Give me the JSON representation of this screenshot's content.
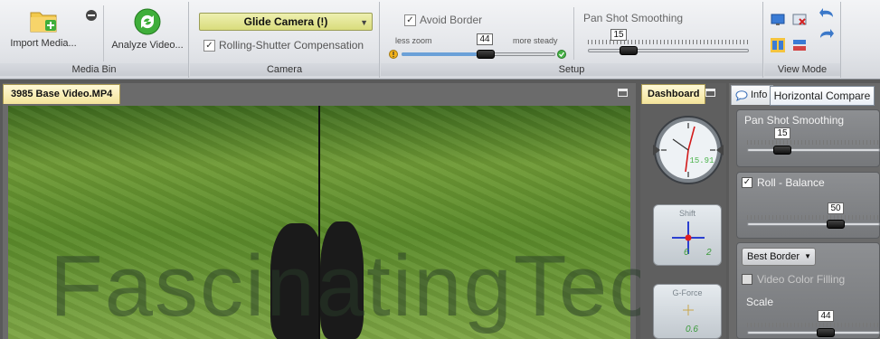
{
  "ribbon": {
    "media_bin": {
      "label": "Media Bin",
      "import_label": "Import Media...",
      "analyze_label": "Analyze Video..."
    },
    "camera": {
      "label": "Camera",
      "mode": "Glide Camera (!)",
      "rolling_shutter_label": "Rolling-Shutter Compensation",
      "rolling_shutter_checked": true
    },
    "setup": {
      "label": "Setup",
      "avoid_border_label": "Avoid Border",
      "avoid_border_checked": true,
      "zoom_value": "44",
      "zoom_fraction": 0.44,
      "less_zoom_label": "less zoom",
      "more_steady_label": "more steady",
      "pan_smoothing_label": "Pan Shot Smoothing",
      "pan_smoothing_value": "15",
      "pan_smoothing_fraction": 0.15
    },
    "view_mode": {
      "label": "View Mode"
    }
  },
  "video": {
    "tab_label": "3985 Base Video.MP4",
    "watermark": "FascinatingTech.com"
  },
  "dashboard": {
    "tab_label": "Dashboard",
    "clock_readout": "15.91",
    "shift_label": "Shift",
    "shift_x": "6",
    "shift_y": "2",
    "gforce_label": "G-Force",
    "gforce_value": "0.6"
  },
  "right_panel": {
    "info_tab_label": "Info",
    "tooltip": "Horizontal Compare",
    "pan_smoothing_label": "Pan Shot Smoothing",
    "pan_smoothing_value": "15",
    "roll_label": "Roll - Balance",
    "roll_checked": true,
    "roll_value": "50",
    "border_dropdown": "Best Border",
    "video_color_filling_label": "Video Color Filling",
    "scale_label": "Scale",
    "scale_value": "44"
  },
  "colors": {
    "accent_blue": "#6aa0d8",
    "tab_yellow": "#f3e39a",
    "camera_dropdown": "#d9dc7c"
  }
}
